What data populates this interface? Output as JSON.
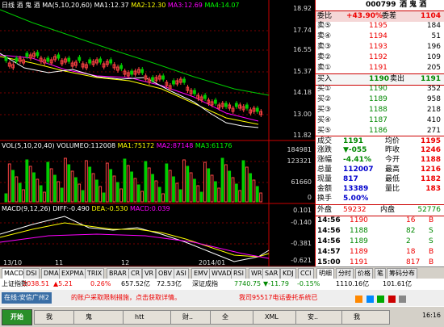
{
  "chart": {
    "period_label": "日线",
    "stock_name": "酒 鬼 酒",
    "ma_label": "MA(5,10,20,60)",
    "ma1": "MA1:12.37",
    "ma2": "MA2:12.30",
    "ma3": "MA3:12.69",
    "ma4": "MA4:14.07",
    "price_ticks": [
      "18.92",
      "17.74",
      "16.55",
      "15.37",
      "14.18",
      "13.00",
      "11.82"
    ],
    "vol_title": "VOL(5,10,20,40)",
    "vol_value": "VOLUMEO:112008",
    "vol_ma1": "MA1:75172",
    "vol_ma2": "MA2:87148",
    "vol_ma3": "MA3:61176",
    "vol_ticks": [
      "184981",
      "123321",
      "61660",
      "0"
    ],
    "macd_title": "MACD(9,12,26)",
    "macd_diff": "DIFF:-0.490",
    "macd_dea": "DEA:-0.530",
    "macd_val": "MACD:0.039",
    "macd_ticks": [
      "0.101",
      "-0.140",
      "-0.381",
      "-0.621"
    ],
    "date_labels": [
      "13/10",
      "11",
      "12",
      "2014/01"
    ]
  },
  "quote": {
    "code": "000799",
    "name": "酒 鬼 酒",
    "weibi_label": "委比",
    "weibi": "+43.90%",
    "weicha_label": "委差",
    "weicha": "1104",
    "sell": [
      {
        "label": "卖⑤",
        "price": "1195",
        "vol": "184"
      },
      {
        "label": "卖④",
        "price": "1194",
        "vol": "51"
      },
      {
        "label": "卖③",
        "price": "1193",
        "vol": "196"
      },
      {
        "label": "卖②",
        "price": "1192",
        "vo": "",
        "vol": "109"
      },
      {
        "label": "卖①",
        "price": "1191",
        "vol": "205"
      }
    ],
    "buy1_label": "买入",
    "buy1": "1190",
    "sell1_label": "卖出",
    "sell1": "1191",
    "buy": [
      {
        "label": "买①",
        "price": "1190",
        "vol": "352"
      },
      {
        "label": "买②",
        "price": "1189",
        "vol": "958"
      },
      {
        "label": "买③",
        "price": "1188",
        "vol": "218"
      },
      {
        "label": "买④",
        "price": "1187",
        "vol": "410"
      },
      {
        "label": "买⑤",
        "price": "1186",
        "vol": "271"
      }
    ],
    "stats": [
      {
        "l1": "成交",
        "v1": "1191",
        "l2": "均价",
        "v2": "1195"
      },
      {
        "l1": "涨跌",
        "v1": "▼-055",
        "l2": "昨收",
        "v2": "1246"
      },
      {
        "l1": "涨幅",
        "v1": "-4.41%",
        "l2": "今开",
        "v2": "1188"
      },
      {
        "l1": "总量",
        "v1": "112007",
        "l2": "最高",
        "v2": "1216"
      },
      {
        "l1": "现量",
        "v1": "817",
        "l2": "最低",
        "v2": "1182"
      },
      {
        "l1": "金额",
        "v1": "13389",
        "l2": "量比",
        "v2": "183"
      },
      {
        "l1": "换手",
        "v1": "5.00%",
        "l2": "",
        "v2": ""
      }
    ],
    "outer_label": "外盘",
    "outer": "59232",
    "inner_label": "内盘",
    "inner": "52776",
    "ticks": [
      {
        "time": "14:56",
        "price": "1190",
        "vol": "16",
        "side": "B"
      },
      {
        "time": "14:56",
        "price": "1188",
        "vol": "82",
        "side": "S"
      },
      {
        "time": "14:56",
        "price": "1189",
        "vol": "2",
        "side": "S"
      },
      {
        "time": "14:57",
        "price": "1189",
        "vol": "18",
        "side": "B"
      },
      {
        "time": "15:00",
        "price": "1191",
        "vol": "817",
        "side": "B"
      }
    ]
  },
  "tabs": {
    "left": [
      "MACD",
      "DSI",
      "DMA",
      "EXPMA",
      "TRIX",
      "BRAR",
      "CR",
      "VR",
      "OBV",
      "ASI",
      "EMV",
      "WVAD",
      "RSI",
      "WR",
      "SAR",
      "KDJ",
      "CCI"
    ],
    "right": [
      "明细",
      "分时",
      "价格",
      "笔",
      "筹码分布"
    ]
  },
  "index_bar": {
    "sh_label": "上证指数",
    "sh_val": "2038.51",
    "sh_chg": "▲5.21",
    "sh_pct": "0.26%",
    "sh_amt": "657.52亿",
    "sz_amt": "72.53亿",
    "sz_label": "深证成指",
    "sz_val": "7740.75",
    "sz_chg": "▼-11.79",
    "sz_pct": "-0.15%",
    "sz_amt2": "1110.16亿",
    "total": "101.61亿"
  },
  "marquee": {
    "prefix": "在线:安信广州2",
    "text": "的账户采取限制措施，点击获取详情。",
    "text2": "我司95517电话委托系统已"
  },
  "taskbar": {
    "start": "开始",
    "items": [
      "我",
      "鬼",
      "htt",
      "财..",
      "全",
      "XML",
      "安..",
      "我"
    ],
    "clock": "16:16"
  }
}
